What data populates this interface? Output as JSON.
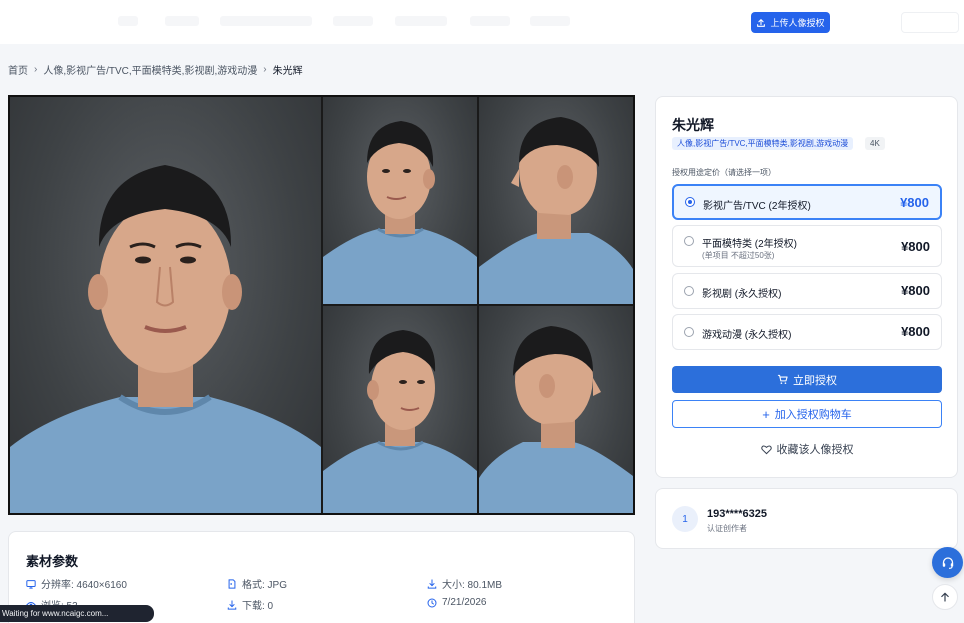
{
  "header": {
    "upload_label": "上传人像授权"
  },
  "breadcrumb": {
    "home": "首页",
    "category": "人像,影视广告/TVC,平面模特类,影视剧,游戏动漫",
    "current": "朱光辉"
  },
  "product": {
    "name": "朱光辉",
    "category_tag": "人像,影视广告/TVC,平面模特类,影视剧,游戏动漫",
    "resolution_tag": "4K",
    "pricing_title": "授权用途定价（请选择一项）",
    "options": [
      {
        "label": "影视广告/TVC (2年授权)",
        "sub": "",
        "price": "¥800",
        "selected": true
      },
      {
        "label": "平面模特类 (2年授权)",
        "sub": "(单项目 不超过50张)",
        "price": "¥800",
        "selected": false
      },
      {
        "label": "影视剧 (永久授权)",
        "sub": "",
        "price": "¥800",
        "selected": false
      },
      {
        "label": "游戏动漫 (永久授权)",
        "sub": "",
        "price": "¥800",
        "selected": false
      }
    ],
    "buy_label": "立即授权",
    "cart_label": "加入授权购物车",
    "favorite_label": "收藏该人像授权"
  },
  "author": {
    "avatar_text": "1",
    "name": "193****6325",
    "role": "认证创作者"
  },
  "params": {
    "title": "素材参数",
    "resolution": "分辨率: 4640×6160",
    "format": "格式: JPG",
    "size": "大小: 80.1MB",
    "views": "浏览: 53",
    "downloads": "下载: 0",
    "date": "7/21/2026"
  },
  "status": {
    "loading_text": "Waiting for www.ncaigc.com..."
  },
  "colors": {
    "accent": "#2563eb",
    "shirt": "#7aa3c8",
    "backdrop": "#44484b"
  }
}
